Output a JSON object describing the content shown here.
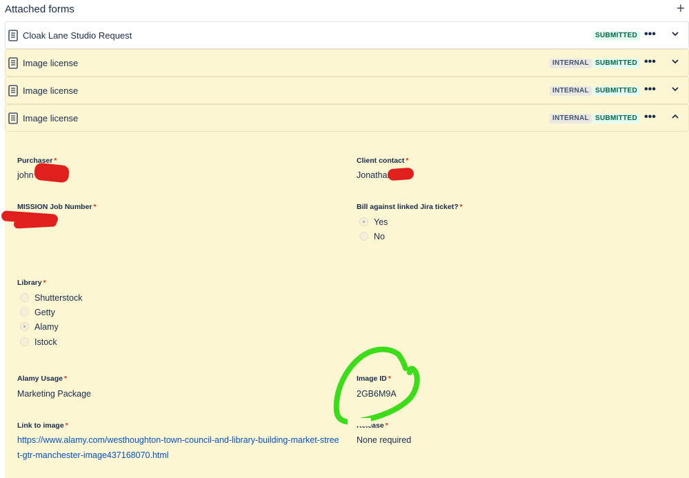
{
  "header": {
    "title": "Attached forms",
    "add_icon": "plus-icon"
  },
  "forms": [
    {
      "name": "Cloak Lane Studio Request",
      "internal": "",
      "status": "SUBMITTED",
      "expanded": false
    },
    {
      "name": "Image license",
      "internal": "INTERNAL",
      "status": "SUBMITTED",
      "expanded": false
    },
    {
      "name": "Image license",
      "internal": "INTERNAL",
      "status": "SUBMITTED",
      "expanded": false
    },
    {
      "name": "Image license",
      "internal": "INTERNAL",
      "status": "SUBMITTED",
      "expanded": true
    }
  ],
  "more_glyph": "•••",
  "required_mark": "*",
  "fields": {
    "purchaser": {
      "label": "Purchaser",
      "value": "john"
    },
    "client_contact": {
      "label": "Client contact",
      "value": "Jonathan"
    },
    "mission_job_number": {
      "label": "MISSION Job Number",
      "value": ""
    },
    "bill_against": {
      "label": "Bill against linked Jira ticket?",
      "options": [
        "Yes",
        "No"
      ],
      "selected": "Yes"
    },
    "library": {
      "label": "Library",
      "options": [
        "Shutterstock",
        "Getty",
        "Alamy",
        "Istock"
      ],
      "selected": "Alamy"
    },
    "alamy_usage": {
      "label": "Alamy Usage",
      "value": "Marketing Package"
    },
    "image_id": {
      "label": "Image ID",
      "value": "2GB6M9A"
    },
    "link_to_image": {
      "label": "Link to image",
      "value": "https://www.alamy.com/westhoughton-town-council-and-library-building-market-street-gtr-manchester-image437168070.html"
    },
    "release": {
      "label": "Release",
      "value": "None required"
    }
  },
  "colors": {
    "yellow_bg": "#fdf6d2",
    "submitted_bg": "#e3fcef",
    "submitted_text": "#006644",
    "link": "#0052cc",
    "required": "#de350b",
    "redaction": "#e0201c",
    "highlight": "#3ddc1a"
  }
}
